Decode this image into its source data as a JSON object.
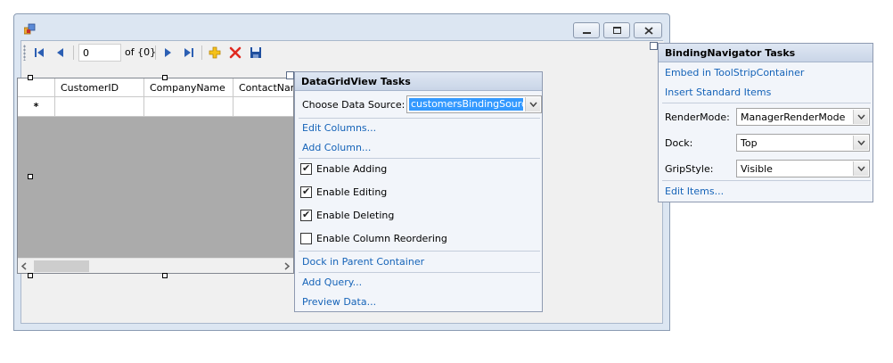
{
  "navigator": {
    "position_value": "0",
    "count_label": "of {0}"
  },
  "grid": {
    "columns": [
      "CustomerID",
      "CompanyName",
      "ContactName"
    ],
    "new_row_marker": "*"
  },
  "dgv_tasks": {
    "title": "DataGridView Tasks",
    "data_source_label": "Choose Data Source:",
    "data_source_value": "customersBindingSource",
    "edit_columns": "Edit Columns...",
    "add_column": "Add Column...",
    "checkboxes": [
      {
        "label": "Enable Adding",
        "checked": true
      },
      {
        "label": "Enable Editing",
        "checked": true
      },
      {
        "label": "Enable Deleting",
        "checked": true
      },
      {
        "label": "Enable Column Reordering",
        "checked": false
      }
    ],
    "dock_link": "Dock in Parent Container",
    "add_query": "Add Query...",
    "preview_data": "Preview Data..."
  },
  "bn_tasks": {
    "title": "BindingNavigator Tasks",
    "embed_link": "Embed in ToolStripContainer",
    "insert_link": "Insert Standard Items",
    "rendermode_label": "RenderMode:",
    "rendermode_value": "ManagerRenderMode",
    "dock_label": "Dock:",
    "dock_value": "Top",
    "gripstyle_label": "GripStyle:",
    "gripstyle_value": "Visible",
    "edit_items": "Edit Items..."
  },
  "colors": {
    "link": "#1563b8",
    "selected_combo": "#3399ff",
    "grid_background": "#ababab"
  }
}
